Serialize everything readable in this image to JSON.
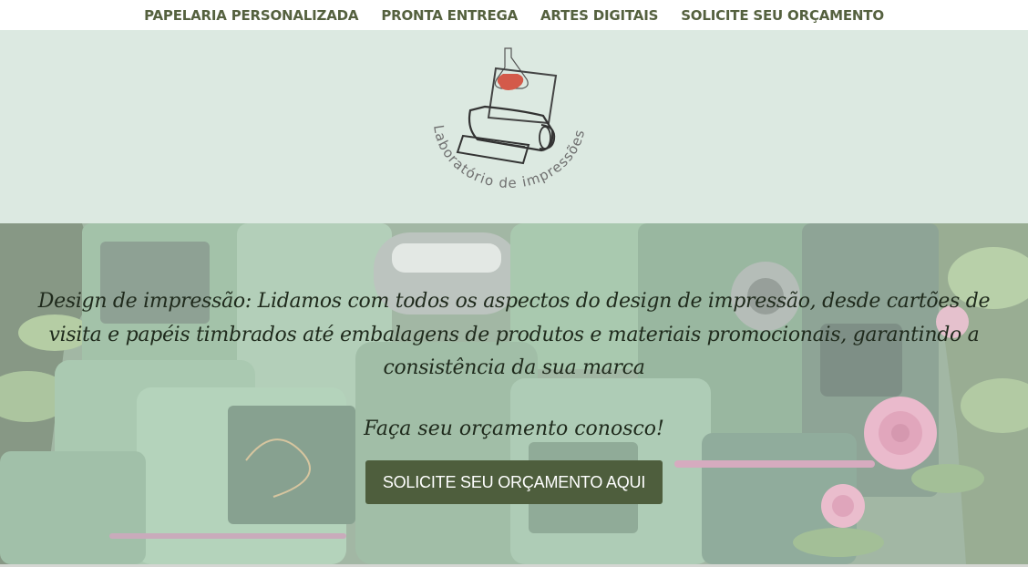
{
  "nav": {
    "items": [
      {
        "label": "PAPELARIA PERSONALIZADA"
      },
      {
        "label": "PRONTA ENTREGA"
      },
      {
        "label": "ARTES DIGITAIS"
      },
      {
        "label": "SOLICITE SEU ORÇAMENTO"
      }
    ]
  },
  "brand": {
    "logo_text": "Laboratório de impressões",
    "logo_icon": "printer-with-heart-icon"
  },
  "hero": {
    "description": "Design de impressão: Lidamos com todos os aspectos do design de impressão, desde cartões de visita e papéis timbrados até embalagens de produtos e materiais promocionais, garantindo a consistência da sua marca",
    "cta_text": "Faça seu orçamento conosco!",
    "cta_button": "SOLICITE SEU ORÇAMENTO AQUI"
  },
  "colors": {
    "nav_text": "#55613f",
    "brand_bg": "#dce9e1",
    "button_bg": "#4e5e3d",
    "accent_pink": "#d9577a"
  }
}
